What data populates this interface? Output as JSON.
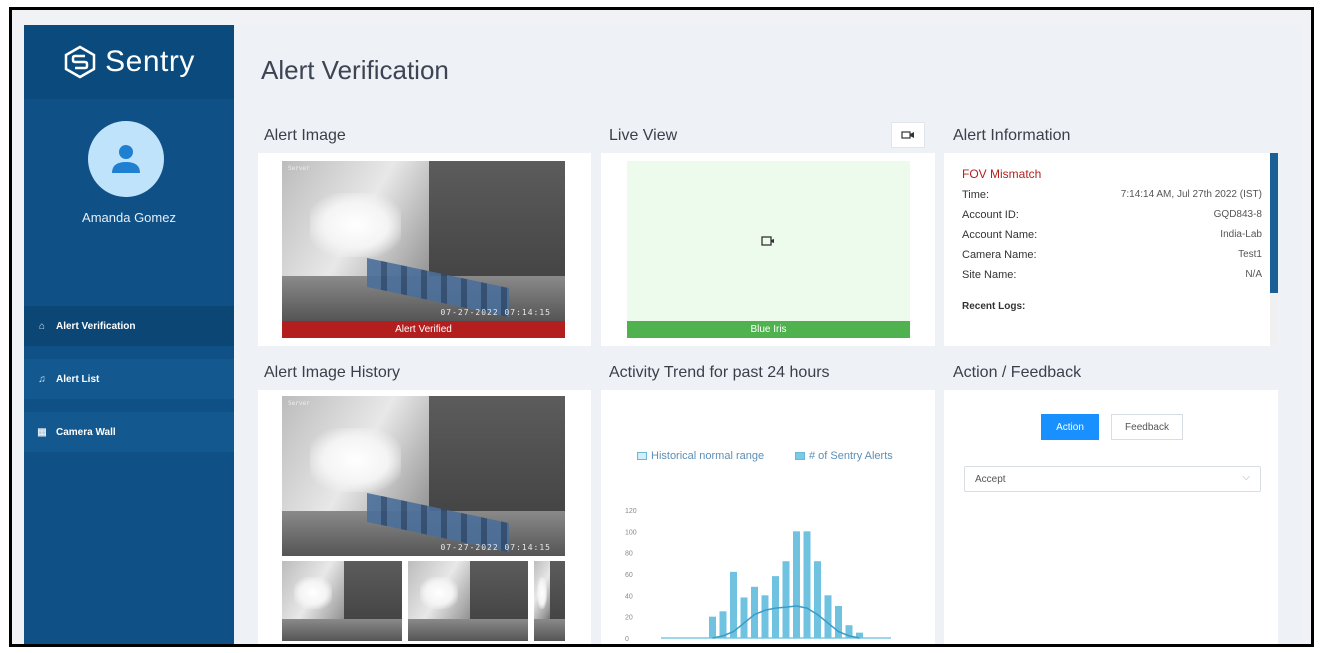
{
  "brand": {
    "name": "Sentry"
  },
  "user": {
    "name": "Amanda Gomez"
  },
  "nav": [
    {
      "label": "Alert Verification",
      "icon": "home-icon"
    },
    {
      "label": "Alert List",
      "icon": "bell-icon"
    },
    {
      "label": "Camera Wall",
      "icon": "grid-icon"
    }
  ],
  "page": {
    "title": "Alert Verification"
  },
  "alert_image": {
    "title": "Alert Image",
    "camera_tag": "Server",
    "timestamp": "07-27-2022 07:14:15",
    "status": "Alert Verified",
    "status_color": "#b31f1f"
  },
  "live_view": {
    "title": "Live View",
    "status": "Blue Iris",
    "status_color": "#4fb24e"
  },
  "alert_info": {
    "title": "Alert Information",
    "alert_type": "FOV Mismatch",
    "rows": [
      {
        "label": "Time:",
        "value": "7:14:14 AM, Jul 27th 2022 (IST)"
      },
      {
        "label": "Account ID:",
        "value": "GQD843-8"
      },
      {
        "label": "Account Name:",
        "value": "India-Lab"
      },
      {
        "label": "Camera Name:",
        "value": "Test1"
      },
      {
        "label": "Site Name:",
        "value": "N/A"
      }
    ],
    "recent_logs_label": "Recent Logs:"
  },
  "history": {
    "title": "Alert Image History",
    "camera_tag": "Server",
    "timestamp": "07-27-2022 07:14:15"
  },
  "activity": {
    "title": "Activity Trend for past 24 hours"
  },
  "chart_data": {
    "type": "bar",
    "legend": [
      "Historical normal range",
      "# of Sentry Alerts"
    ],
    "y_ticks": [
      0,
      20,
      40,
      60,
      80,
      100,
      120
    ],
    "ylim": [
      0,
      120
    ],
    "series": [
      {
        "name": "# of Sentry Alerts",
        "values": [
          20,
          25,
          62,
          38,
          48,
          40,
          58,
          72,
          100,
          100,
          72,
          40,
          30,
          12,
          5
        ]
      },
      {
        "name": "Historical normal range",
        "values": [
          0,
          2,
          6,
          14,
          22,
          26,
          28,
          29,
          30,
          28,
          22,
          14,
          6,
          2,
          0
        ]
      }
    ]
  },
  "feedback": {
    "title": "Action / Feedback",
    "action_label": "Action",
    "feedback_label": "Feedback",
    "select_value": "Accept",
    "accent": "#1890ff"
  }
}
